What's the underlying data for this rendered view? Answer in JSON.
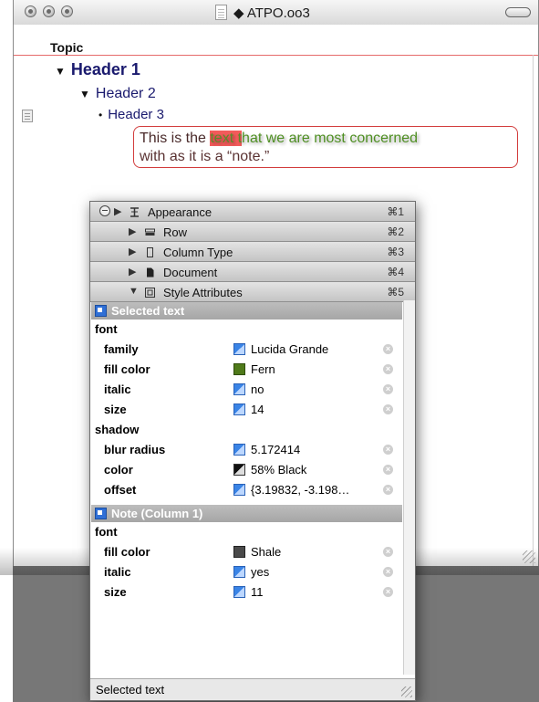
{
  "window": {
    "title": "◆ ATPO.oo3",
    "column_header": "Topic"
  },
  "outline": {
    "header1": "Header 1",
    "header2": "Header 2",
    "header3": "Header 3",
    "note_a": "This is the ",
    "note_b": "text t",
    "note_c": "hat we are most concerned",
    "note_d": "with as it is a “note.”"
  },
  "inspector": {
    "tabs": [
      {
        "label": "Appearance",
        "shortcut": "⌘1",
        "icon": "appearance-icon"
      },
      {
        "label": "Row",
        "shortcut": "⌘2",
        "icon": "row-icon"
      },
      {
        "label": "Column Type",
        "shortcut": "⌘3",
        "icon": "column-type-icon"
      },
      {
        "label": "Document",
        "shortcut": "⌘4",
        "icon": "document-icon"
      },
      {
        "label": "Style Attributes",
        "shortcut": "⌘5",
        "icon": "style-attributes-icon"
      }
    ],
    "sections": [
      {
        "title": "Selected text",
        "groups": [
          {
            "name": "font",
            "attrs": [
              {
                "key": "family",
                "value": "Lucida Grande",
                "swatch": "blue"
              },
              {
                "key": "fill color",
                "value": "Fern",
                "swatch": "#4f7a1a"
              },
              {
                "key": "italic",
                "value": "no",
                "swatch": "blue"
              },
              {
                "key": "size",
                "value": "14",
                "swatch": "blue"
              }
            ]
          },
          {
            "name": "shadow",
            "attrs": [
              {
                "key": "blur radius",
                "value": "5.172414",
                "swatch": "blue"
              },
              {
                "key": "color",
                "value": "58% Black",
                "swatch": "black"
              },
              {
                "key": "offset",
                "value": "{3.19832, -3.198…",
                "swatch": "blue"
              }
            ]
          }
        ]
      },
      {
        "title": "Note (Column 1)",
        "groups": [
          {
            "name": "font",
            "attrs": [
              {
                "key": "fill color",
                "value": "Shale",
                "swatch": "#4a4a4a"
              },
              {
                "key": "italic",
                "value": "yes",
                "swatch": "blue"
              },
              {
                "key": "size",
                "value": "11",
                "swatch": "blue"
              }
            ]
          }
        ]
      }
    ],
    "status": "Selected text"
  }
}
